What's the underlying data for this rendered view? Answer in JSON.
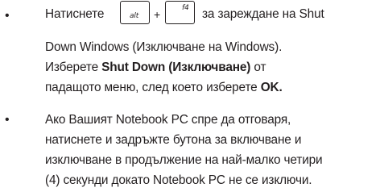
{
  "items": [
    {
      "bullet": "•",
      "intro": "Натиснете",
      "key1": "alt",
      "plus": "+",
      "key2": "f4",
      "after_keys": "за зареждане на Shut",
      "line2": "Down Windows (Изключване на Windows).",
      "line3_pre": "Изберете ",
      "line3_bold": "Shut Down (Изключване)",
      "line3_post": " от",
      "line4_pre": "падащото меню, след което изберете ",
      "line4_bold": "OK."
    },
    {
      "bullet": "•",
      "lines": [
        "Ако Вашият Notebook PC спре да отговаря,",
        "натиснете и задръжте бутона за включване и",
        "изключване в продължение на най-малко четири",
        "(4) секунди докато Notebook PC не се изключи."
      ]
    }
  ]
}
